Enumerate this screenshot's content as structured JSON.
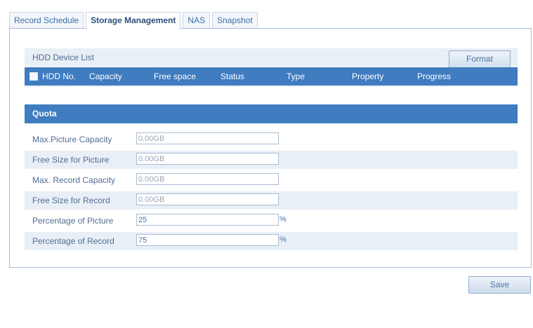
{
  "tabs": [
    {
      "label": "Record Schedule"
    },
    {
      "label": "Storage Management"
    },
    {
      "label": "NAS"
    },
    {
      "label": "Snapshot"
    }
  ],
  "active_tab": "Storage Management",
  "hdd": {
    "title": "HDD Device List",
    "format_label": "Format",
    "columns": [
      "HDD No.",
      "Capacity",
      "Free space",
      "Status",
      "Type",
      "Property",
      "Progress"
    ]
  },
  "quota": {
    "title": "Quota",
    "rows": [
      {
        "label": "Max.Picture Capacity",
        "value": "0.00GB",
        "unit": ""
      },
      {
        "label": "Free Size for Picture",
        "value": "0.00GB",
        "unit": ""
      },
      {
        "label": "Max. Record Capacity",
        "value": "0.00GB",
        "unit": ""
      },
      {
        "label": "Free Size for Record",
        "value": "0.00GB",
        "unit": ""
      },
      {
        "label": "Percentage of Picture",
        "value": "25",
        "unit": "%"
      },
      {
        "label": "Percentage of Record",
        "value": "75",
        "unit": "%"
      }
    ]
  },
  "save_label": "Save"
}
